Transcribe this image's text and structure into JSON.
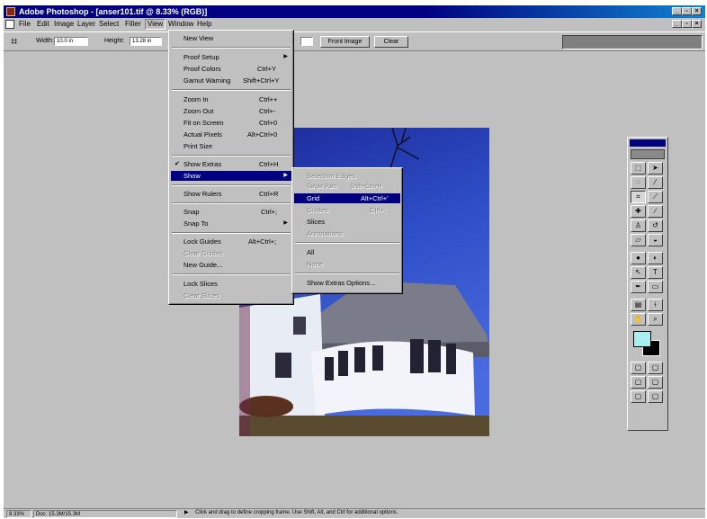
{
  "window": {
    "title": "Adobe Photoshop - [anser101.tif @ 8.33% (RGB)]"
  },
  "menubar": [
    "File",
    "Edit",
    "Image",
    "Layer",
    "Select",
    "Filter",
    "View",
    "Window",
    "Help"
  ],
  "options": {
    "width_label": "Width:",
    "width_value": "10.0 in",
    "height_label": "Height:",
    "height_value": "13.28 in",
    "front_image": "Front Image",
    "clear": "Clear"
  },
  "view_menu": [
    {
      "label": "New View"
    },
    {
      "label": "Proof Setup",
      "submenu": true
    },
    {
      "label": "Proof Colors",
      "shortcut": "Ctrl+Y"
    },
    {
      "label": "Gamut Warning",
      "shortcut": "Shift+Ctrl+Y"
    },
    {
      "label": "Zoom In",
      "shortcut": "Ctrl++"
    },
    {
      "label": "Zoom Out",
      "shortcut": "Ctrl+-"
    },
    {
      "label": "Fit on Screen",
      "shortcut": "Ctrl+0"
    },
    {
      "label": "Actual Pixels",
      "shortcut": "Alt+Ctrl+0"
    },
    {
      "label": "Print Size"
    },
    {
      "label": "Show Extras",
      "shortcut": "Ctrl+H",
      "checked": true
    },
    {
      "label": "Show",
      "submenu": true,
      "highlighted": true
    },
    {
      "label": "Show Rulers",
      "shortcut": "Ctrl+R"
    },
    {
      "label": "Snap",
      "shortcut": "Ctrl+;"
    },
    {
      "label": "Snap To",
      "submenu": true
    },
    {
      "label": "Lock Guides",
      "shortcut": "Alt+Ctrl+;"
    },
    {
      "label": "Clear Guides",
      "disabled": true
    },
    {
      "label": "New Guide..."
    },
    {
      "label": "Lock Slices"
    },
    {
      "label": "Clear Slices",
      "disabled": true
    }
  ],
  "show_submenu": [
    {
      "label": "Selection Edges",
      "disabled": true
    },
    {
      "label": "Target Path",
      "shortcut": "Shift+Ctrl+H",
      "disabled": true
    },
    {
      "label": "Grid",
      "shortcut": "Alt+Ctrl+'",
      "highlighted": true
    },
    {
      "label": "Guides",
      "shortcut": "Ctrl+;",
      "disabled": true
    },
    {
      "label": "Slices"
    },
    {
      "label": "Annotations",
      "disabled": true
    },
    {
      "label": "All"
    },
    {
      "label": "None",
      "disabled": true
    },
    {
      "label": "Show Extras Options..."
    }
  ],
  "status": {
    "zoom": "8.33%",
    "doc": "Doc: 15.3M/15.3M",
    "hint": "Click and drag to define cropping frame. Use Shift, Alt, and Ctrl for additional options."
  },
  "colors": {
    "title_bar": "#000080",
    "chrome": "#c0c0c0",
    "highlight": "#000080",
    "foreground_swatch": "#a8f0f0",
    "background_swatch": "#000000"
  },
  "tools": [
    "marquee-icon",
    "move-icon",
    "lasso-icon",
    "magic-wand-icon",
    "crop-icon",
    "slice-icon",
    "healing-brush-icon",
    "brush-icon",
    "clone-stamp-icon",
    "history-brush-icon",
    "eraser-icon",
    "paint-bucket-icon",
    "blur-icon",
    "dodge-icon",
    "path-select-icon",
    "type-icon",
    "pen-icon",
    "shape-icon",
    "notes-icon",
    "eyedropper-icon",
    "hand-icon",
    "zoom-icon"
  ]
}
